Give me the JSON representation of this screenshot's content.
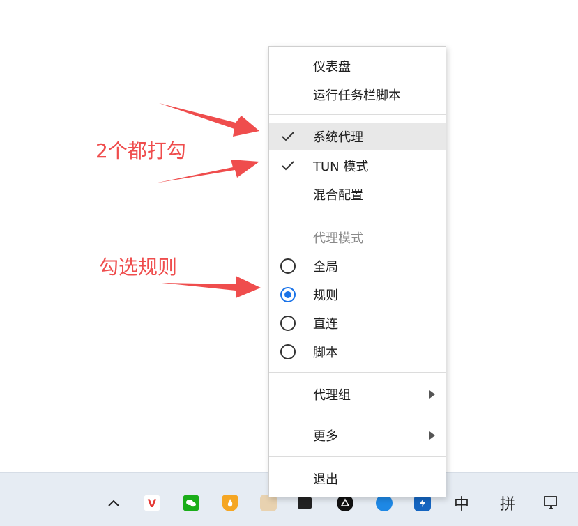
{
  "menu": {
    "dashboard": "仪表盘",
    "run_taskbar_script": "运行任务栏脚本",
    "system_proxy": "系统代理",
    "tun_mode": "TUN 模式",
    "mixed_config": "混合配置",
    "proxy_mode_section": "代理模式",
    "mode_global": "全局",
    "mode_rule": "规则",
    "mode_direct": "直连",
    "mode_script": "脚本",
    "proxy_group": "代理组",
    "more": "更多",
    "exit": "退出",
    "selected_mode": "规则",
    "system_proxy_checked": true,
    "tun_mode_checked": true
  },
  "annotations": {
    "check_both": "2个都打勾",
    "select_rule": "勾选规则"
  },
  "taskbar": {
    "ime_lang": "中",
    "ime_mode": "拼"
  },
  "colors": {
    "annotation": "#ef4d4d",
    "radio_selected": "#1a73e8",
    "hover_bg": "#e8e8e8"
  }
}
